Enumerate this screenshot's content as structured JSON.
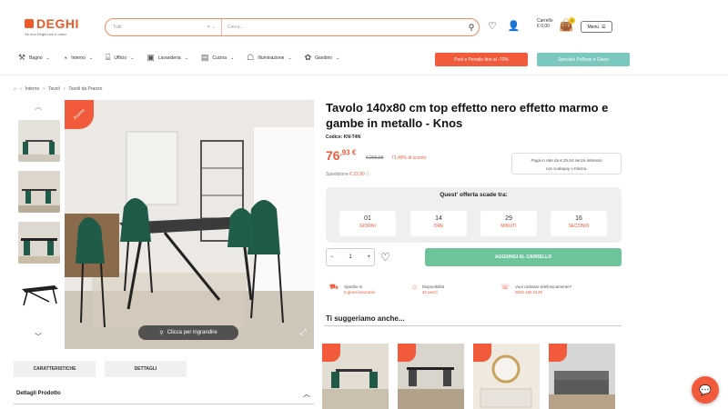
{
  "header": {
    "logo_text": "DEGHI",
    "logo_tagline": "Se non Deghi non è unico",
    "search_category": "Tutti",
    "search_placeholder": "Cerca...",
    "cart_label": "Carrello",
    "cart_total": "€ 0,00",
    "cart_count": "0",
    "menu_label": "Menu"
  },
  "nav": {
    "items": [
      {
        "label": "Bagno",
        "icon": "faucet-icon"
      },
      {
        "label": "Interno",
        "icon": "lamp-icon"
      },
      {
        "label": "Ufficio",
        "icon": "desk-icon"
      },
      {
        "label": "Lavanderia",
        "icon": "washer-icon"
      },
      {
        "label": "Cucina",
        "icon": "kitchen-icon"
      },
      {
        "label": "Illuminazione",
        "icon": "light-icon"
      },
      {
        "label": "Giardino",
        "icon": "plant-icon"
      }
    ],
    "promo_left": "Pool e Pensile fino al -70%",
    "promo_right": "Speciale Pallone e Gioco"
  },
  "breadcrumb": [
    "Interno",
    "Tavoli",
    "Tavoli da Pranzo"
  ],
  "gallery": {
    "promo_badge": "Promo",
    "zoom_label": "Clicca per ingrandire"
  },
  "product": {
    "title": "Tavolo 140x80 cm top effetto nero effetto marmo e gambe in metallo - Knos",
    "code_label": "Codice: KN-T4N",
    "price_int": "76",
    "price_dec": ",93 €",
    "old_price": "€ 269,99",
    "discount": "71,40% di sconto",
    "shipping": "Spedizione",
    "shipping_price": "€ 22,90",
    "pay_line1": "Paga in rate da € 25,64 senza interessi",
    "pay_line2": "con scalapay o Klarna.",
    "offer_title": "Quest' offerta scade tra:",
    "countdown": [
      {
        "value": "01",
        "unit": "GIORNI"
      },
      {
        "value": "14",
        "unit": "ORE"
      },
      {
        "value": "29",
        "unit": "MINUTI"
      },
      {
        "value": "16",
        "unit": "SECONDI"
      }
    ],
    "qty": "1",
    "add_to_cart": "AGGIUNGI AL CARRELLO",
    "features": [
      {
        "title": "Spedito in",
        "value": "5 giorni lavorativi",
        "icon": "truck-icon"
      },
      {
        "title": "Disponibilità",
        "value": "25 pezzi",
        "icon": "box-icon"
      },
      {
        "title": "Vuoi ordinare telefonicamente?",
        "value": "0832 156 0129",
        "icon": "phone-icon"
      }
    ]
  },
  "tabs": {
    "characteristics": "CARATTERISTICHE",
    "details": "DETTAGLI"
  },
  "details_header": "Dettagli Prodotto",
  "suggestions_title": "Ti suggeriamo anche...",
  "colors": {
    "accent": "#f15a3b",
    "green": "#6cc49a",
    "teal": "#7bc8bf"
  }
}
